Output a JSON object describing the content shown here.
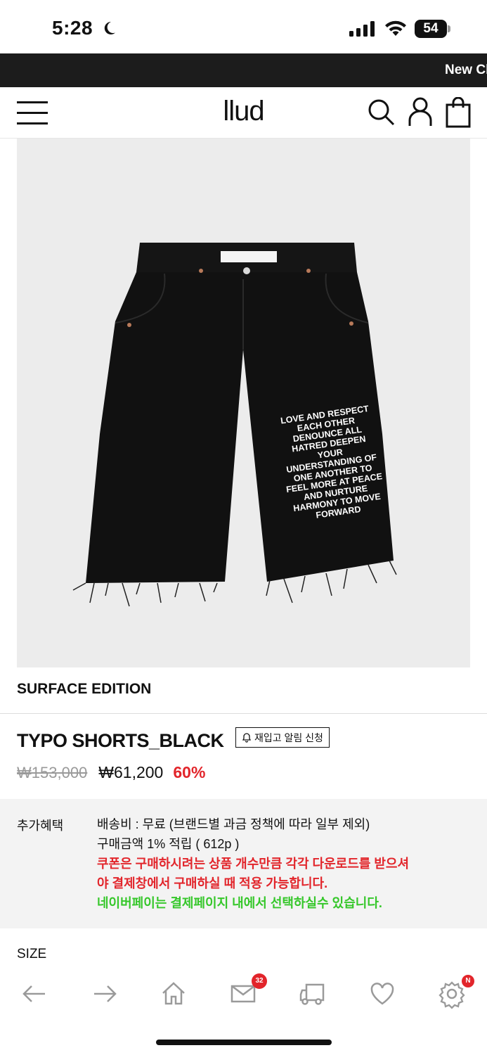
{
  "status_bar": {
    "time": "5:28",
    "battery": "54"
  },
  "announcement": "New Cl",
  "header": {
    "logo": "llud"
  },
  "product": {
    "image_text": [
      "LOVE AND RESPECT",
      "EACH OTHER",
      "DENOUNCE ALL",
      "HATRED DEEPEN",
      "YOUR",
      "UNDERSTANDING OF",
      "ONE ANOTHER TO",
      "FEEL MORE AT PEACE",
      "AND NURTURE",
      "HARMONY TO MOVE",
      "FORWARD"
    ],
    "brand": "SURFACE EDITION",
    "name": "TYPO SHORTS_BLACK",
    "restock_label": "재입고 알림 신청",
    "original_price": "₩153,000",
    "sale_price": "₩61,200",
    "discount": "60%"
  },
  "benefits": {
    "label": "추가혜택",
    "lines": [
      "배송비 : 무료 (브랜드별 과금 정책에 따라 일부 제외)",
      "구매금액 1% 적립 ( 612p )",
      "쿠폰은 구매하시려는 상품 개수만큼 각각 다운로드를 받으셔",
      "야 결제창에서 구매하실 때 적용 가능합니다.",
      "네이버페이는 결제페이지 내에서 선택하실수 있습니다."
    ]
  },
  "size_label": "SIZE",
  "bottom_nav": {
    "mail_badge": "32",
    "settings_badge": "N",
    "icons": [
      "back-arrow-icon",
      "forward-arrow-icon",
      "home-icon",
      "mail-icon",
      "truck-icon",
      "heart-icon",
      "gear-icon"
    ]
  },
  "colors": {
    "accent_red": "#e2252b",
    "accent_green": "#35c72a",
    "dark_bar": "#1c1c1c"
  }
}
